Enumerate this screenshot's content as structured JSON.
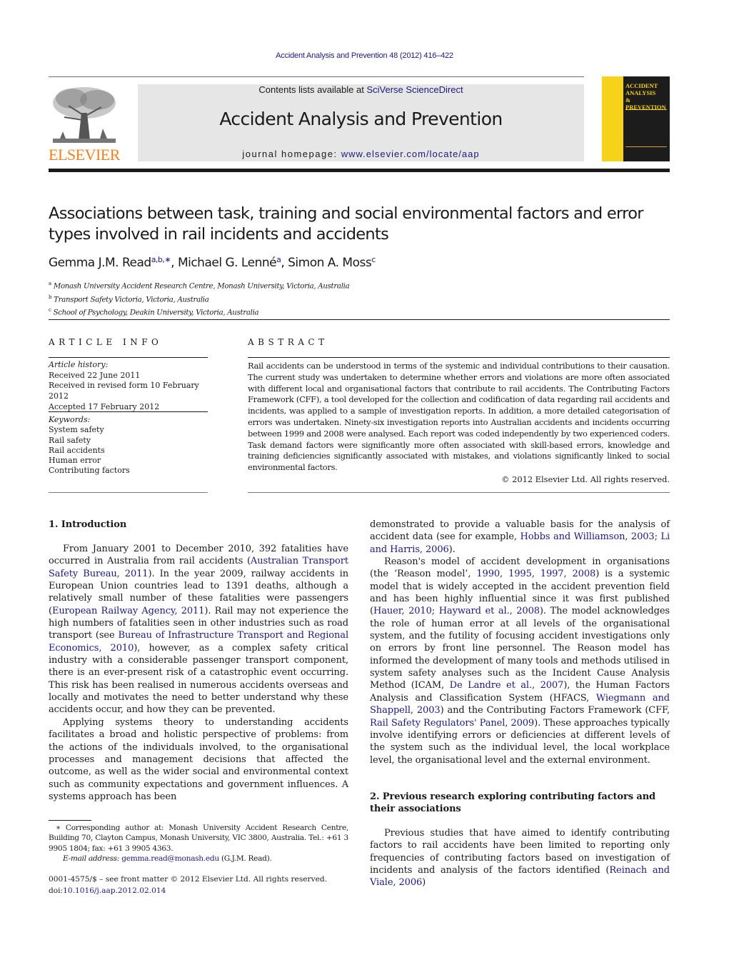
{
  "header": {
    "journal_ref": "Accident Analysis and Prevention 48 (2012) 416–422",
    "contents_prefix": "Contents lists available at ",
    "contents_link": "SciVerse ScienceDirect",
    "journal_title": "Accident Analysis and Prevention",
    "homepage_prefix": "journal homepage: ",
    "homepage_link": "www.elsevier.com/locate/aap",
    "publisher_logo_text": "ELSEVIER",
    "cover_title_lines": [
      "ACCIDENT",
      "ANALYSIS",
      "&",
      "PREVENTION"
    ],
    "colors": {
      "publisher_orange": "#f0821e",
      "cover_yellow": "#f7d21a",
      "link_blue": "#1a1a7e"
    }
  },
  "article": {
    "title": "Associations between task, training and social environmental factors and error types involved in rail incidents and accidents",
    "authors": [
      {
        "name": "Gemma J.M. Read",
        "marks": "a,b,∗"
      },
      {
        "name": "Michael G. Lenné",
        "marks": "a"
      },
      {
        "name": "Simon A. Moss",
        "marks": "c"
      }
    ],
    "affiliations": [
      {
        "mark": "a",
        "text": "Monash University Accident Research Centre, Monash University, Victoria, Australia"
      },
      {
        "mark": "b",
        "text": "Transport Safety Victoria, Victoria, Australia"
      },
      {
        "mark": "c",
        "text": "School of Psychology, Deakin University, Victoria, Australia"
      }
    ]
  },
  "article_info": {
    "heading": "ARTICLE INFO",
    "history_label": "Article history:",
    "history": [
      "Received 22 June 2011",
      "Received in revised form 10 February 2012",
      "Accepted 17 February 2012"
    ],
    "keywords_label": "Keywords:",
    "keywords": [
      "System safety",
      "Rail safety",
      "Rail accidents",
      "Human error",
      "Contributing factors"
    ]
  },
  "abstract": {
    "heading": "ABSTRACT",
    "text": "Rail accidents can be understood in terms of the systemic and individual contributions to their causation. The current study was undertaken to determine whether errors and violations are more often associated with different local and organisational factors that contribute to rail accidents. The Contributing Factors Framework (CFF), a tool developed for the collection and codification of data regarding rail accidents and incidents, was applied to a sample of investigation reports. In addition, a more detailed categorisation of errors was undertaken. Ninety-six investigation reports into Australian accidents and incidents occurring between 1999 and 2008 were analysed. Each report was coded independently by two experienced coders. Task demand factors were significantly more often associated with skill-based errors, knowledge and training deficiencies significantly associated with mistakes, and violations significantly linked to social environmental factors.",
    "copyright": "© 2012 Elsevier Ltd. All rights reserved."
  },
  "sections": {
    "intro_heading": "1.  Introduction",
    "p1": [
      "From January 2001 to December 2010, 392 fatalities have occurred in Australia from rail accidents (",
      "Australian Transport Safety Bureau, 2011",
      "). In the year 2009, railway accidents in European Union countries lead to 1391 deaths, although a relatively small number of these fatalities were passengers (",
      "European Railway Agency, 2011",
      "). Rail may not experience the high numbers of fatalities seen in other industries such as road transport (see ",
      "Bureau of Infrastructure Transport and Regional Economics, 2010",
      "), however, as a complex safety critical industry with a considerable passenger transport component, there is an ever-present risk of a catastrophic event occurring. This risk has been realised in numerous accidents overseas and locally and motivates the need to better understand why these accidents occur, and how they can be prevented."
    ],
    "p2": "Applying systems theory to understanding accidents facilitates a broad and holistic perspective of problems: from the actions of the individuals involved, to the organisational processes and management decisions that affected the outcome, as well as the wider social and environmental context such as community expectations and government influences. A systems approach has been",
    "p3": [
      "demonstrated to provide a valuable basis for the analysis of accident data (see for example, ",
      "Hobbs and Williamson, 2003; Li and Harris, 2006",
      ")."
    ],
    "p4": [
      "Reason's model of accident development in organisations (the ‘Reason model’, ",
      "1990, 1995, 1997, 2008",
      ") is a systemic model that is widely accepted in the accident prevention field and has been highly influential since it was first published (",
      "Hauer, 2010; Hayward et al., 2008",
      "). The model acknowledges the role of human error at all levels of the organisational system, and the futility of focusing accident investigations only on errors by front line personnel. The Reason model has informed the development of many tools and methods utilised in system safety analyses such as the Incident Cause Analysis Method (ICAM, ",
      "De Landre et al., 2007",
      "), the Human Factors Analysis and Classification System (HFACS, ",
      "Wiegmann and Shappell, 2003",
      ") and the Contributing Factors Framework (CFF, ",
      "Rail Safety Regulators' Panel, 2009",
      "). These approaches typically involve identifying errors or deficiencies at different levels of the system such as the individual level, the local workplace level, the organisational level and the external environment."
    ],
    "sec2_heading": "2.  Previous research exploring contributing factors and their associations",
    "p5": [
      "Previous studies that have aimed to identify contributing factors to rail accidents have been limited to reporting only frequencies of contributing factors based on investigation of incidents and analysis of the factors identified (",
      "Reinach and Viale, 2006",
      ")"
    ]
  },
  "footnote": {
    "mark": "∗",
    "text": "Corresponding author at: Monash University Accident Research Centre, Building 70, Clayton Campus, Monash University, VIC 3800, Australia. Tel.: +61 3 9905 1804; fax: +61 3 9905 4363.",
    "email_label": "E-mail address:",
    "email": "gemma.read@monash.edu",
    "email_suffix": " (G.J.M. Read)."
  },
  "front_matter": {
    "issn_line": "0001-4575/$ – see front matter © 2012 Elsevier Ltd. All rights reserved.",
    "doi_prefix": "doi:",
    "doi": "10.1016/j.aap.2012.02.014"
  }
}
